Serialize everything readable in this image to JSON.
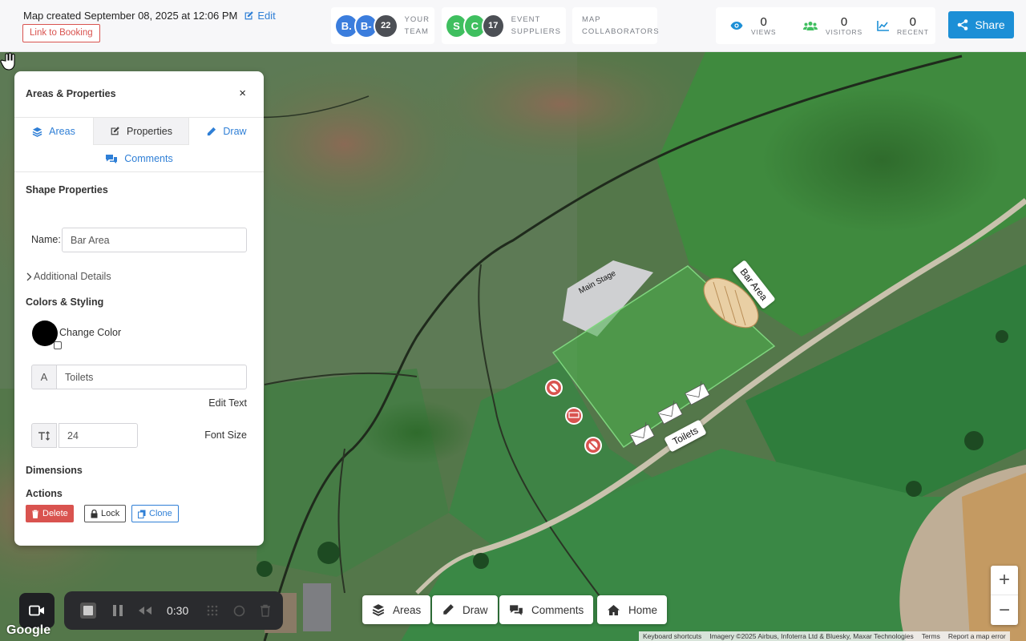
{
  "header": {
    "map_created": "Map created September 08, 2025 at 12:06 PM",
    "edit_label": "Edit",
    "link_booking": "Link to Booking",
    "team": {
      "avatars": [
        "B.",
        "B-"
      ],
      "count": "22",
      "label_line1": "YOUR",
      "label_line2": "TEAM"
    },
    "suppliers": {
      "avatars": [
        "S",
        "C"
      ],
      "count": "17",
      "label_line1": "EVENT",
      "label_line2": "SUPPLIERS"
    },
    "collaborators": {
      "label_line1": "MAP",
      "label_line2": "COLLABORATORS"
    },
    "stats": [
      {
        "value": "0",
        "label": "VIEWS",
        "icon": "eye-icon"
      },
      {
        "value": "0",
        "label": "VISITORS",
        "icon": "users-icon"
      },
      {
        "value": "0",
        "label": "RECENT",
        "icon": "chart-line-icon"
      }
    ],
    "share_label": "Share"
  },
  "panel": {
    "title": "Areas & Properties",
    "close": "×",
    "tabs": {
      "areas": "Areas",
      "properties": "Properties",
      "draw": "Draw",
      "comments": "Comments"
    },
    "shape_properties": "Shape Properties",
    "name_label": "Name:",
    "name_value": "Bar Area",
    "additional_details": "Additional Details",
    "colors_styling": "Colors & Styling",
    "change_color": "Change Color",
    "text_addon": "A",
    "text_value": "Toilets",
    "edit_text": "Edit Text",
    "font_size_value": "24",
    "font_size_label": "Font Size",
    "dimensions": "Dimensions",
    "actions": "Actions",
    "delete": "Delete",
    "lock": "Lock",
    "clone": "Clone"
  },
  "map": {
    "labels": {
      "main_stage": "Main Stage",
      "bar_area": "Bar Area",
      "toilets": "Toilets"
    },
    "colors": {
      "area_fill": "#49b24a",
      "accent_blue": "#1c8fd6",
      "danger": "#d9534f"
    }
  },
  "recorder": {
    "time": "0:30"
  },
  "bottom_nav": {
    "areas": "Areas",
    "draw": "Draw",
    "comments": "Comments",
    "home": "Home"
  },
  "zoom": {
    "in": "+",
    "out": "−"
  },
  "footer": {
    "google": "Google",
    "keyboard_shortcuts": "Keyboard shortcuts",
    "imagery": "Imagery ©2025 Airbus, Infoterra Ltd & Bluesky, Maxar Technologies",
    "terms": "Terms",
    "report": "Report a map error"
  }
}
